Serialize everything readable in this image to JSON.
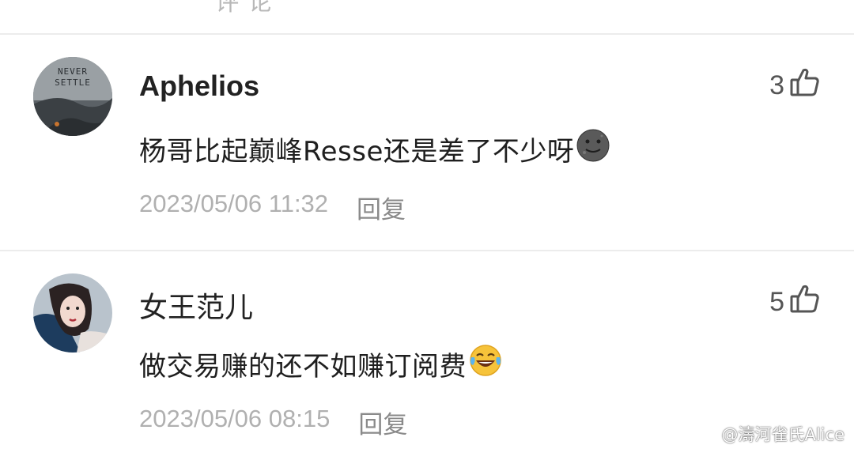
{
  "top_fragment": "“ ‘ ’ ” 评 论",
  "comments": [
    {
      "username": "Aphelios",
      "avatar_text_1": "NEVER",
      "avatar_text_2": "SETTLE",
      "likes": "3",
      "text": "杨哥比起巅峰Resse还是差了不少呀",
      "emoji": "moon-face-emoji",
      "timestamp": "2023/05/06 11:32",
      "reply_label": "回复"
    },
    {
      "username": "女王范儿",
      "likes": "5",
      "text": "做交易赚的还不如赚订阅费",
      "emoji": "laughing-tears-emoji",
      "timestamp": "2023/05/06 08:15",
      "reply_label": "回复"
    }
  ],
  "watermark": "@濤河雀氏Alice",
  "colors": {
    "text": "#1f1f1f",
    "meta": "#b0b0b0",
    "divider": "#ececec"
  }
}
